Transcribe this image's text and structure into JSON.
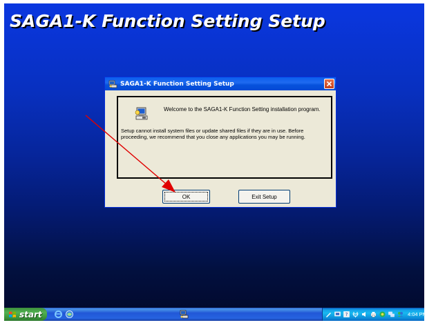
{
  "desktop": {
    "banner_title": "SAGA1-K Function Setting Setup"
  },
  "dialog": {
    "title": "SAGA1-K Function Setting Setup",
    "welcome_text": "Welcome to the SAGA1-K Function Setting installation program.",
    "info_text": "Setup cannot install system files or update shared files if they are in use. Before proceeding, we recommend that you close any applications you may be running.",
    "ok_label": "OK",
    "exit_label": "Exit Setup",
    "icons": {
      "title": "setup-icon",
      "close": "close-icon",
      "body": "setup-computer-icon"
    }
  },
  "taskbar": {
    "start_label": "start",
    "clock": "4:04 PM",
    "quick_launch": [
      "ie-icon",
      "browser-icon"
    ],
    "task_icon": "setup-icon",
    "tray_icons": [
      "pen-icon",
      "network-icon",
      "help-icon",
      "plug-icon",
      "sound-icon",
      "printer-icon",
      "security-icon",
      "network-connection-icon",
      "messenger-icon"
    ]
  },
  "colors": {
    "desktop_top": "#0a37e0",
    "desktop_bottom": "#01082a",
    "annotation_arrow": "#e00000",
    "taskbar": "#2157d7",
    "start_button": "#3d9a3d"
  }
}
